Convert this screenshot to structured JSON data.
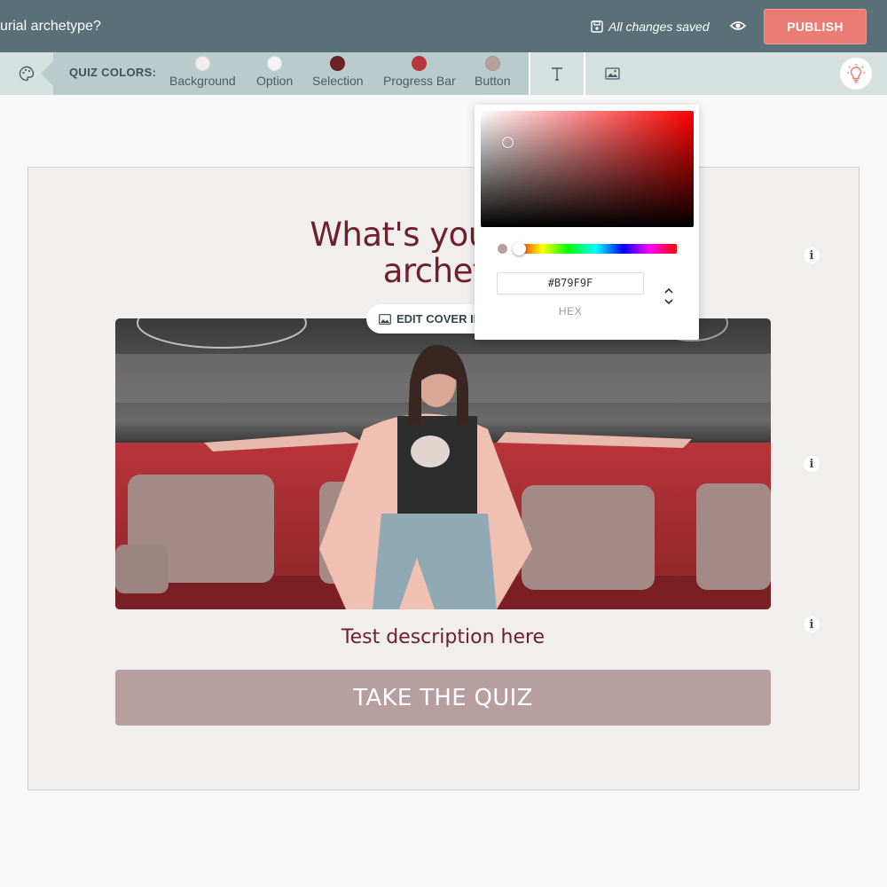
{
  "header": {
    "title": "urial archetype?",
    "saved_status": "All changes saved",
    "publish_label": "PUBLISH"
  },
  "toolbar": {
    "quiz_colors_label": "QUIZ COLORS:",
    "swatches": [
      {
        "label": "Background",
        "color": "#f1efee"
      },
      {
        "label": "Option",
        "color": "#f4f4f4"
      },
      {
        "label": "Selection",
        "color": "#6e2128"
      },
      {
        "label": "Progress Bar",
        "color": "#b9363c"
      },
      {
        "label": "Button",
        "color": "#b79f9f"
      }
    ],
    "text_tool_icon": "text-icon",
    "image_tool_icon": "image-icon",
    "tips_icon": "lightbulb-icon"
  },
  "quiz": {
    "title": "What's your entr\narchety",
    "edit_cover_label": "EDIT COVER IN",
    "description": "Test description here",
    "cta_label": "TAKE THE QUIZ"
  },
  "color_picker": {
    "hex_value": "#B79F9F",
    "mode_label": "HEX",
    "selected_color": "#b79f9f"
  }
}
